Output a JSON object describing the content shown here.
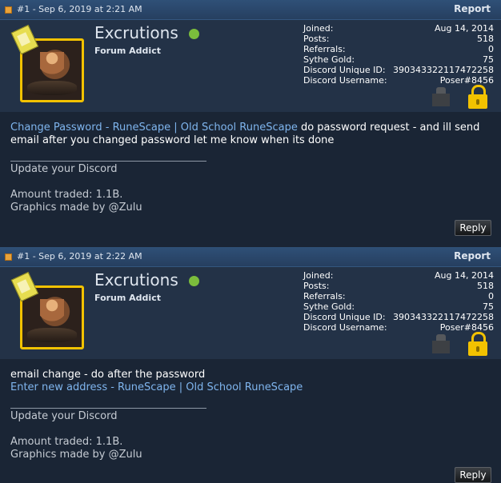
{
  "posts": [
    {
      "meta": "#1 - Sep 6, 2019 at 2:21 AM",
      "report": "Report",
      "user": {
        "name": "Excrutions",
        "title": "Forum Addict",
        "stats": [
          {
            "label": "Joined:",
            "value": "Aug 14, 2014"
          },
          {
            "label": "Posts:",
            "value": "518"
          },
          {
            "label": "Referrals:",
            "value": "0"
          },
          {
            "label": "Sythe Gold:",
            "value": "75"
          },
          {
            "label": "Discord Unique ID:",
            "value": "390343322117472258"
          },
          {
            "label": "Discord Username:",
            "value": "Poser#8456"
          }
        ]
      },
      "body_link": "Change Password - RuneScape | Old School RuneScape",
      "body_text": " do password request - and ill send email after you changed password let me know when its done",
      "signature": [
        "Update your Discord",
        "Amount traded: 1.1B.",
        "Graphics made by @Zulu"
      ],
      "reply": "Reply"
    },
    {
      "meta": "#1 - Sep 6, 2019 at 2:22 AM",
      "report": "Report",
      "user": {
        "name": "Excrutions",
        "title": "Forum Addict",
        "stats": [
          {
            "label": "Joined:",
            "value": "Aug 14, 2014"
          },
          {
            "label": "Posts:",
            "value": "518"
          },
          {
            "label": "Referrals:",
            "value": "0"
          },
          {
            "label": "Sythe Gold:",
            "value": "75"
          },
          {
            "label": "Discord Unique ID:",
            "value": "390343322117472258"
          },
          {
            "label": "Discord Username:",
            "value": "Poser#8456"
          }
        ]
      },
      "body_text": "email change - do after the password",
      "body_link": "Enter new address - RuneScape | Old School RuneScape",
      "signature": [
        "Update your Discord",
        "Amount traded: 1.1B.",
        "Graphics made by @Zulu"
      ],
      "reply": "Reply"
    }
  ],
  "colors": {
    "header": "#2f5077",
    "userbar": "#233247",
    "background": "#1a2535",
    "link": "#7fb5ee",
    "online": "#7bbd3c",
    "avatar_border": "#f2c200"
  },
  "icons": [
    "post-icon",
    "online-status-icon",
    "security-icon",
    "lock-icon",
    "badge-icon"
  ]
}
